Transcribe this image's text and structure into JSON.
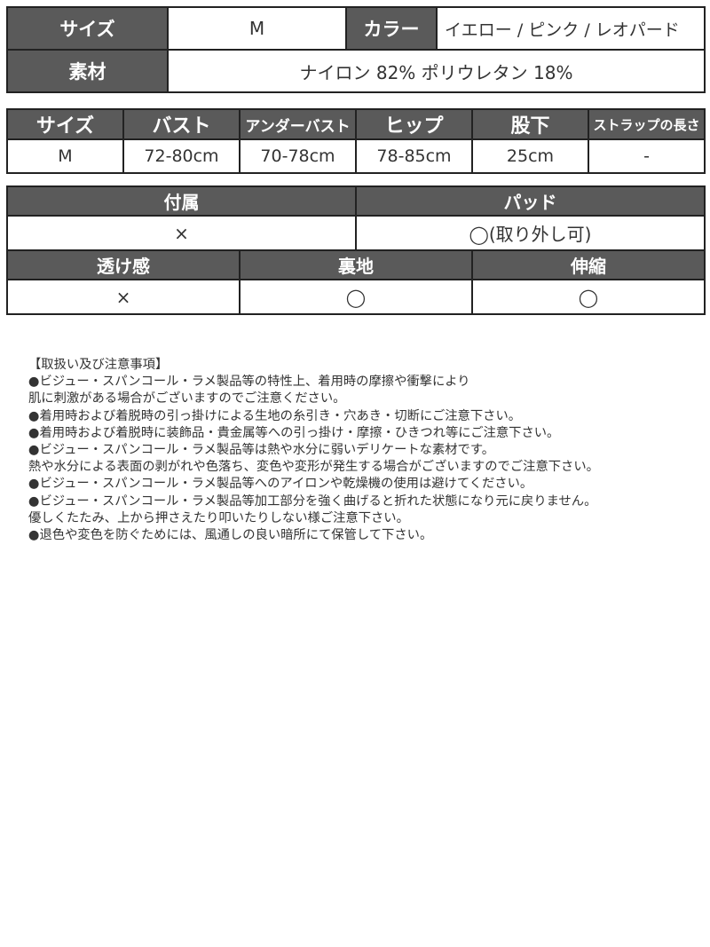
{
  "spec_table": {
    "size_label": "サイズ",
    "size_value": "M",
    "color_label": "カラー",
    "color_value": "イエロー / ピンク / レオパード",
    "material_label": "素材",
    "material_value": "ナイロン 82%  ポリウレタン 18%"
  },
  "measure_table": {
    "headers": [
      "サイズ",
      "バスト",
      "アンダーバスト",
      "ヒップ",
      "股下",
      "ストラップの長さ"
    ],
    "rows": [
      [
        "M",
        "72-80cm",
        "70-78cm",
        "78-85cm",
        "25cm",
        "-"
      ]
    ]
  },
  "feature_table": {
    "row1_headers": [
      "付属",
      "パッド"
    ],
    "row1_values": [
      "×",
      "◯(取り外し可)"
    ],
    "row2_headers": [
      "透け感",
      "裏地",
      "伸縮"
    ],
    "row2_values": [
      "×",
      "◯",
      "◯"
    ]
  },
  "notes": {
    "title": "【取扱い及び注意事項】",
    "lines": [
      "●ビジュー・スパンコール・ラメ製品等の特性上、着用時の摩擦や衝撃により",
      "肌に刺激がある場合がございますのでご注意ください。",
      "●着用時および着脱時の引っ掛けによる生地の糸引き・穴あき・切断にご注意下さい。",
      "●着用時および着脱時に装飾品・貴金属等への引っ掛け・摩擦・ひきつれ等にご注意下さい。",
      "●ビジュー・スパンコール・ラメ製品等は熱や水分に弱いデリケートな素材です。",
      "熱や水分による表面の剥がれや色落ち、変色や変形が発生する場合がございますのでご注意下さい。",
      "●ビジュー・スパンコール・ラメ製品等へのアイロンや乾燥機の使用は避けてください。",
      "●ビジュー・スパンコール・ラメ製品等加工部分を強く曲げると折れた状態になり元に戻りません。",
      "優しくたたみ、上から押さえたり叩いたりしない様ご注意下さい。",
      "●退色や変色を防ぐためには、風通しの良い暗所にて保管して下さい。"
    ]
  }
}
